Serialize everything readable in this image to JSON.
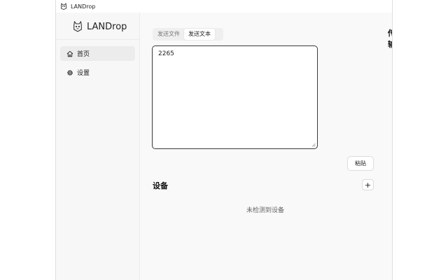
{
  "window": {
    "title": "LANDrop"
  },
  "sidebar": {
    "brand": "LANDrop",
    "items": [
      {
        "label": "首页",
        "icon": "home-icon"
      },
      {
        "label": "设置",
        "icon": "gear-icon"
      }
    ]
  },
  "main": {
    "tabs": [
      {
        "label": "发送文件"
      },
      {
        "label": "发送文本"
      }
    ],
    "text_value": "2265",
    "paste_label": "粘贴",
    "transfer_title": "传输",
    "devices_title": "设备",
    "add_label": "+",
    "empty_devices": "未检测到设备"
  }
}
